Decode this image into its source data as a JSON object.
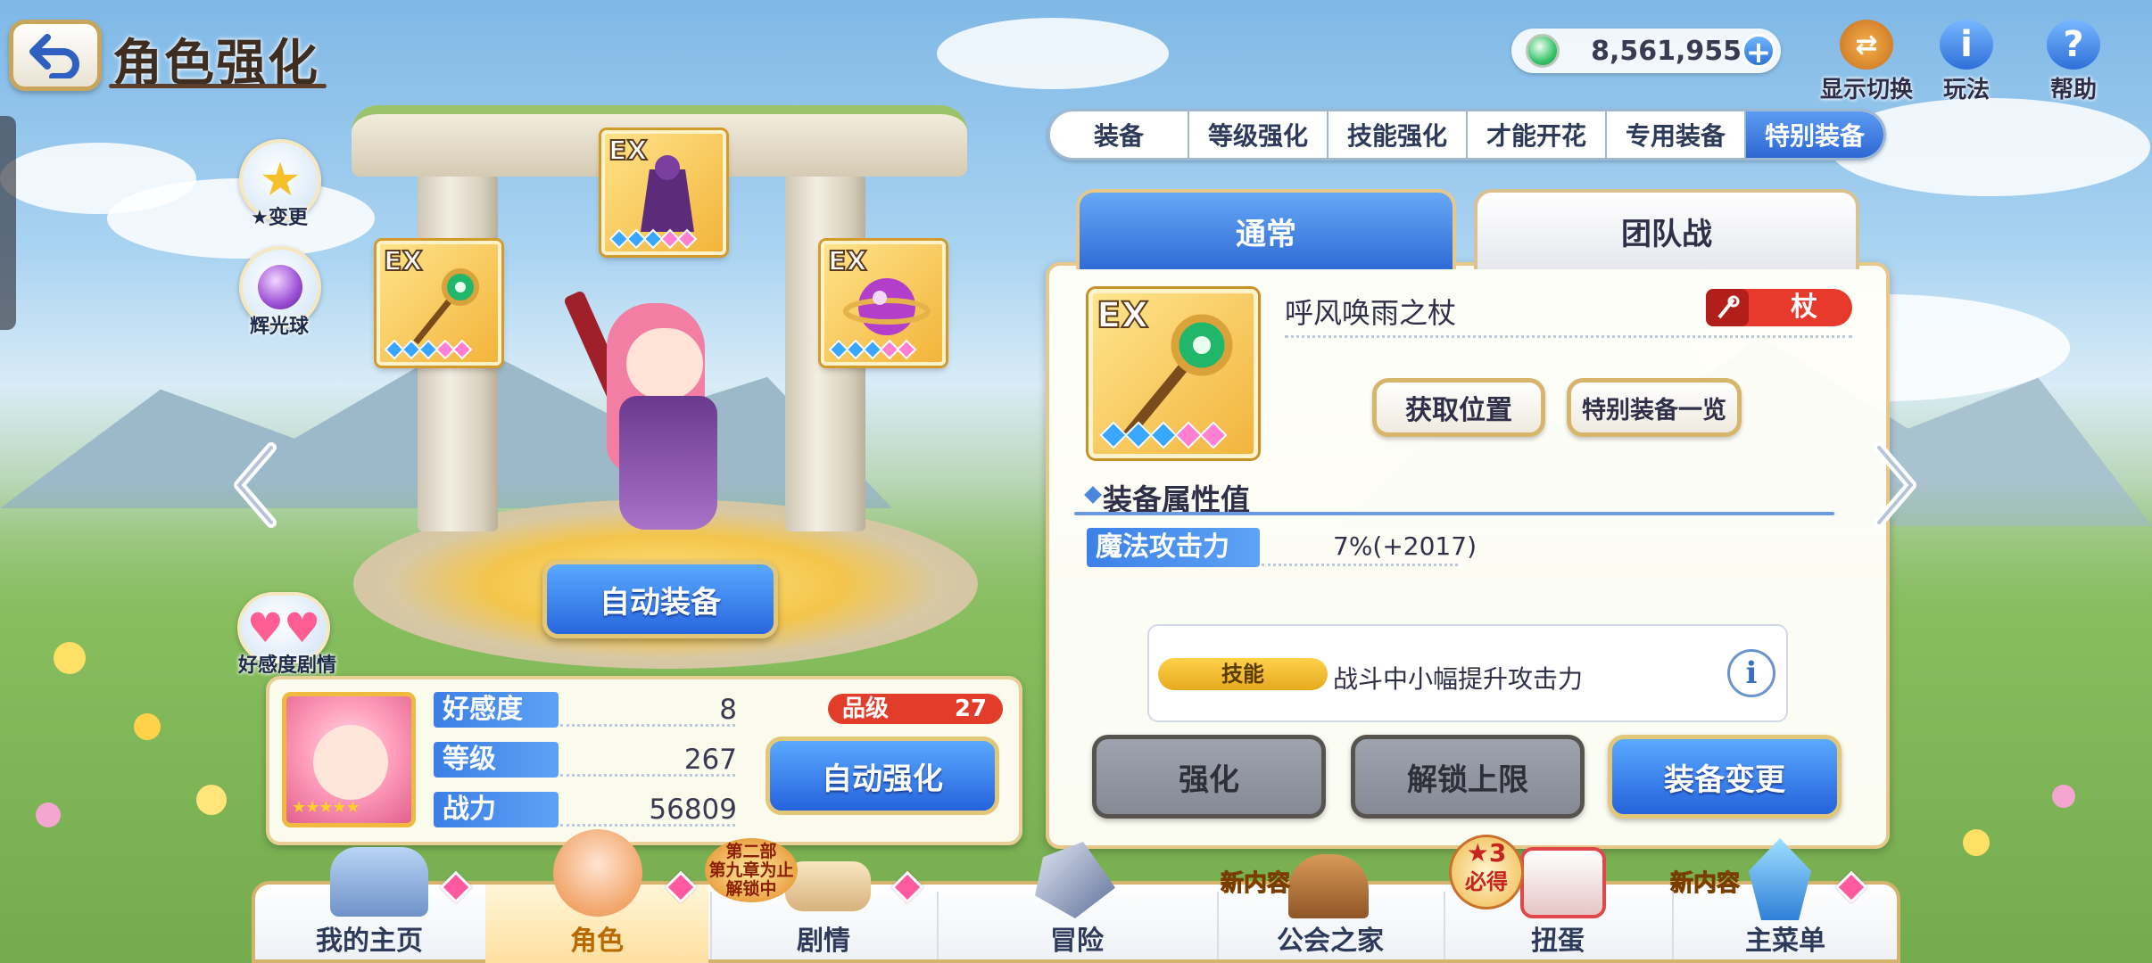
{
  "header": {
    "title": "角色强化",
    "currency_value": "8,561,955",
    "display_toggle_label": "显示切换",
    "how_to_play_label": "玩法",
    "help_label": "帮助"
  },
  "side_buttons": {
    "star_change_label": "★变更",
    "glow_orb_label": "辉光球",
    "affinity_story_label": "好感度剧情"
  },
  "ex_badge": "EX",
  "character": {
    "auto_equip_label": "自动装备",
    "stats": [
      {
        "label": "好感度",
        "value": "8"
      },
      {
        "label": "等级",
        "value": "267"
      },
      {
        "label": "战力",
        "value": "56809"
      }
    ],
    "grade_label": "品级",
    "grade_value": "27",
    "auto_enhance_label": "自动强化"
  },
  "tabs": [
    {
      "label": "装备",
      "active": false
    },
    {
      "label": "等级强化",
      "active": false
    },
    {
      "label": "技能强化",
      "active": false
    },
    {
      "label": "才能开花",
      "active": false
    },
    {
      "label": "专用装备",
      "active": false
    },
    {
      "label": "特别装备",
      "active": true
    }
  ],
  "subtabs": {
    "normal": "通常",
    "clan_battle": "团队战"
  },
  "equipment": {
    "name": "呼风唤雨之杖",
    "type": "杖",
    "get_location_label": "获取位置",
    "special_list_label": "特别装备一览",
    "section_title": "装备属性值",
    "attr_label": "魔法攻击力",
    "attr_value": "7%(+2017)",
    "skill_tag": "技能",
    "skill_desc": "战斗中小幅提升攻击力"
  },
  "actions": {
    "enhance": "强化",
    "unlock_limit": "解锁上限",
    "change_equipment": "装备变更"
  },
  "nav": {
    "items": [
      "我的主页",
      "角色",
      "剧情",
      "冒险",
      "公会之家",
      "扭蛋",
      "主菜单"
    ],
    "story_badge_lines": [
      "第二部",
      "第九章为止",
      "解锁中"
    ],
    "new_content_label": "新内容",
    "gacha_badge_top": "3",
    "gacha_badge_bottom": "必得"
  },
  "colors": {
    "accent_blue": "#2d67d4",
    "gold_border": "#e3c779",
    "red_badge": "#e23d2a"
  }
}
